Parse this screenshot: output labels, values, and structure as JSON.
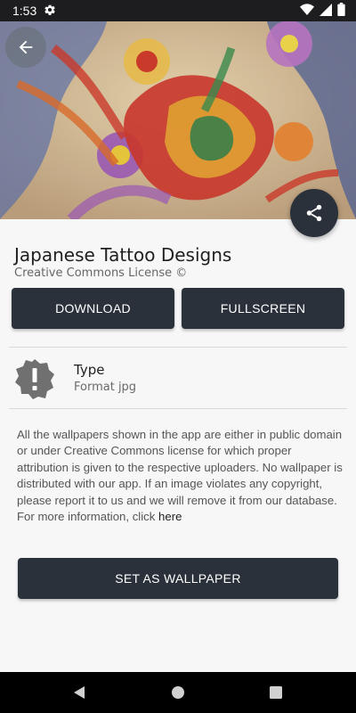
{
  "status_bar": {
    "time": "1:53",
    "icons": [
      "gear-icon",
      "wifi-icon",
      "signal-icon",
      "battery-icon"
    ]
  },
  "hero": {
    "image_subject": "japanese-tattoo-phoenix-back"
  },
  "wallpaper": {
    "title": "Japanese Tattoo Designs",
    "license": "Creative Commons License ©"
  },
  "actions": {
    "download_label": "DOWNLOAD",
    "fullscreen_label": "FULLSCREEN",
    "set_wallpaper_label": "SET AS WALLPAPER"
  },
  "type_info": {
    "label": "Type",
    "value": "Format jpg"
  },
  "disclaimer": {
    "text": "All the wallpapers shown in the app are either in public domain or under Creative Commons license for which proper attribution is given to the respective uploaders. No wallpaper is distributed with our app. If an image violates any copyright, please report it to us and we will remove it from our database. For more information, click",
    "link_text": "here"
  },
  "colors": {
    "button_bg": "#2a313b",
    "status_bar_bg": "#1d1d1f",
    "nav_bar_bg": "#000000",
    "page_bg": "#f7f7f7"
  }
}
